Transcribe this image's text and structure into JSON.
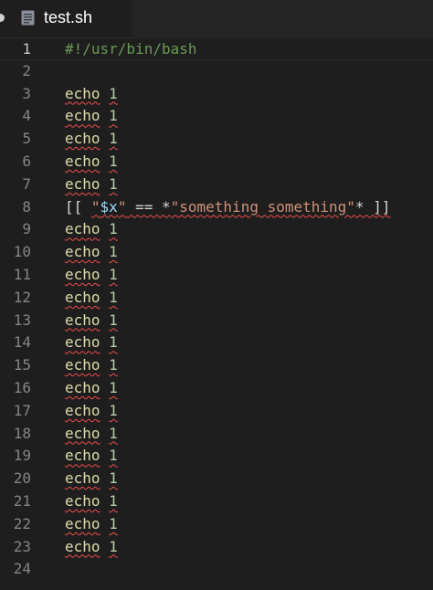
{
  "tab": {
    "title": "test.sh",
    "icon": "file-icon",
    "modified_dot_color": "#cfcfcf"
  },
  "colors": {
    "background": "#1e1e1e",
    "line_number": "#858585",
    "comment": "#6a9955",
    "command": "#dcdcaa",
    "number": "#b5cea8",
    "string": "#ce9178",
    "variable": "#9cdcfe",
    "squiggle": "#f14c4c"
  },
  "current_line": 1,
  "lines": [
    {
      "number": "1",
      "tokens": [
        {
          "text": "#!/usr/bin/bash",
          "type": "comment"
        }
      ]
    },
    {
      "number": "2",
      "tokens": []
    },
    {
      "number": "3",
      "tokens": [
        {
          "text": "echo",
          "type": "cmd",
          "squiggle": true
        },
        {
          "text": " ",
          "type": "plain"
        },
        {
          "text": "1",
          "type": "num",
          "squiggle": true
        }
      ]
    },
    {
      "number": "4",
      "tokens": [
        {
          "text": "echo",
          "type": "cmd",
          "squiggle": true
        },
        {
          "text": " ",
          "type": "plain"
        },
        {
          "text": "1",
          "type": "num",
          "squiggle": true
        }
      ]
    },
    {
      "number": "5",
      "tokens": [
        {
          "text": "echo",
          "type": "cmd",
          "squiggle": true
        },
        {
          "text": " ",
          "type": "plain"
        },
        {
          "text": "1",
          "type": "num",
          "squiggle": true
        }
      ]
    },
    {
      "number": "6",
      "tokens": [
        {
          "text": "echo",
          "type": "cmd",
          "squiggle": true
        },
        {
          "text": " ",
          "type": "plain"
        },
        {
          "text": "1",
          "type": "num",
          "squiggle": true
        }
      ]
    },
    {
      "number": "7",
      "tokens": [
        {
          "text": "echo",
          "type": "cmd",
          "squiggle": true
        },
        {
          "text": " ",
          "type": "plain"
        },
        {
          "text": "1",
          "type": "num",
          "squiggle": true
        }
      ]
    },
    {
      "number": "8",
      "tokens": [
        {
          "text": "[[ ",
          "type": "plain"
        },
        {
          "text": "\"",
          "type": "str",
          "squiggle": true
        },
        {
          "text": "$x",
          "type": "var",
          "squiggle": true
        },
        {
          "text": "\"",
          "type": "str",
          "squiggle": true
        },
        {
          "text": " == *",
          "type": "plain",
          "squiggle": true
        },
        {
          "text": "\"something something\"",
          "type": "str",
          "squiggle": true
        },
        {
          "text": "* ]]",
          "type": "plain",
          "squiggle": true
        }
      ]
    },
    {
      "number": "9",
      "tokens": [
        {
          "text": "echo",
          "type": "cmd",
          "squiggle": true
        },
        {
          "text": " ",
          "type": "plain"
        },
        {
          "text": "1",
          "type": "num",
          "squiggle": true
        }
      ]
    },
    {
      "number": "10",
      "tokens": [
        {
          "text": "echo",
          "type": "cmd",
          "squiggle": true
        },
        {
          "text": " ",
          "type": "plain"
        },
        {
          "text": "1",
          "type": "num",
          "squiggle": true
        }
      ]
    },
    {
      "number": "11",
      "tokens": [
        {
          "text": "echo",
          "type": "cmd",
          "squiggle": true
        },
        {
          "text": " ",
          "type": "plain"
        },
        {
          "text": "1",
          "type": "num",
          "squiggle": true
        }
      ]
    },
    {
      "number": "12",
      "tokens": [
        {
          "text": "echo",
          "type": "cmd",
          "squiggle": true
        },
        {
          "text": " ",
          "type": "plain"
        },
        {
          "text": "1",
          "type": "num",
          "squiggle": true
        }
      ]
    },
    {
      "number": "13",
      "tokens": [
        {
          "text": "echo",
          "type": "cmd",
          "squiggle": true
        },
        {
          "text": " ",
          "type": "plain"
        },
        {
          "text": "1",
          "type": "num",
          "squiggle": true
        }
      ]
    },
    {
      "number": "14",
      "tokens": [
        {
          "text": "echo",
          "type": "cmd",
          "squiggle": true
        },
        {
          "text": " ",
          "type": "plain"
        },
        {
          "text": "1",
          "type": "num",
          "squiggle": true
        }
      ]
    },
    {
      "number": "15",
      "tokens": [
        {
          "text": "echo",
          "type": "cmd",
          "squiggle": true
        },
        {
          "text": " ",
          "type": "plain"
        },
        {
          "text": "1",
          "type": "num",
          "squiggle": true
        }
      ]
    },
    {
      "number": "16",
      "tokens": [
        {
          "text": "echo",
          "type": "cmd",
          "squiggle": true
        },
        {
          "text": " ",
          "type": "plain"
        },
        {
          "text": "1",
          "type": "num",
          "squiggle": true
        }
      ]
    },
    {
      "number": "17",
      "tokens": [
        {
          "text": "echo",
          "type": "cmd",
          "squiggle": true
        },
        {
          "text": " ",
          "type": "plain"
        },
        {
          "text": "1",
          "type": "num",
          "squiggle": true
        }
      ]
    },
    {
      "number": "18",
      "tokens": [
        {
          "text": "echo",
          "type": "cmd",
          "squiggle": true
        },
        {
          "text": " ",
          "type": "plain"
        },
        {
          "text": "1",
          "type": "num",
          "squiggle": true
        }
      ]
    },
    {
      "number": "19",
      "tokens": [
        {
          "text": "echo",
          "type": "cmd",
          "squiggle": true
        },
        {
          "text": " ",
          "type": "plain"
        },
        {
          "text": "1",
          "type": "num",
          "squiggle": true
        }
      ]
    },
    {
      "number": "20",
      "tokens": [
        {
          "text": "echo",
          "type": "cmd",
          "squiggle": true
        },
        {
          "text": " ",
          "type": "plain"
        },
        {
          "text": "1",
          "type": "num",
          "squiggle": true
        }
      ]
    },
    {
      "number": "21",
      "tokens": [
        {
          "text": "echo",
          "type": "cmd",
          "squiggle": true
        },
        {
          "text": " ",
          "type": "plain"
        },
        {
          "text": "1",
          "type": "num",
          "squiggle": true
        }
      ]
    },
    {
      "number": "22",
      "tokens": [
        {
          "text": "echo",
          "type": "cmd",
          "squiggle": true
        },
        {
          "text": " ",
          "type": "plain"
        },
        {
          "text": "1",
          "type": "num",
          "squiggle": true
        }
      ]
    },
    {
      "number": "23",
      "tokens": [
        {
          "text": "echo",
          "type": "cmd",
          "squiggle": true
        },
        {
          "text": " ",
          "type": "plain"
        },
        {
          "text": "1",
          "type": "num",
          "squiggle": true
        }
      ]
    },
    {
      "number": "24",
      "tokens": []
    }
  ]
}
